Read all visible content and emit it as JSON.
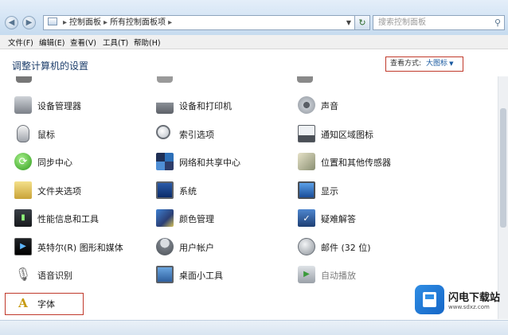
{
  "address": {
    "segments": [
      "控制面板",
      "所有控制面板项"
    ],
    "search_placeholder": "搜索控制面板"
  },
  "menu": [
    "文件(F)",
    "编辑(E)",
    "查看(V)",
    "工具(T)",
    "帮助(H)"
  ],
  "heading": "调整计算机的设置",
  "view_by": {
    "label": "查看方式:",
    "value": "大图标"
  },
  "items": [
    {
      "label": "设备管理器",
      "icon": "device-manager-icon"
    },
    {
      "label": "设备和打印机",
      "icon": "printer-icon"
    },
    {
      "label": "声音",
      "icon": "speaker-icon"
    },
    {
      "label": "鼠标",
      "icon": "mouse-icon"
    },
    {
      "label": "索引选项",
      "icon": "indexing-icon"
    },
    {
      "label": "通知区域图标",
      "icon": "notification-icon"
    },
    {
      "label": "同步中心",
      "icon": "sync-icon"
    },
    {
      "label": "网络和共享中心",
      "icon": "network-icon"
    },
    {
      "label": "位置和其他传感器",
      "icon": "sensor-icon"
    },
    {
      "label": "文件夹选项",
      "icon": "folder-icon"
    },
    {
      "label": "系统",
      "icon": "computer-icon"
    },
    {
      "label": "显示",
      "icon": "display-icon"
    },
    {
      "label": "性能信息和工具",
      "icon": "performance-icon"
    },
    {
      "label": "颜色管理",
      "icon": "color-icon"
    },
    {
      "label": "疑难解答",
      "icon": "troubleshoot-icon"
    },
    {
      "label": "英特尔(R) 图形和媒体",
      "icon": "intel-graphics-icon"
    },
    {
      "label": "用户帐户",
      "icon": "users-icon"
    },
    {
      "label": "邮件 (32 位)",
      "icon": "mail-icon"
    },
    {
      "label": "语音识别",
      "icon": "microphone-icon"
    },
    {
      "label": "桌面小工具",
      "icon": "gadgets-icon"
    },
    {
      "label": "自动播放",
      "icon": "autoplay-icon"
    },
    {
      "label": "字体",
      "icon": "fonts-icon"
    }
  ],
  "watermark": {
    "title": "闪电下载站",
    "url": "www.sdxz.com"
  },
  "colors": {
    "highlight": "#c0392b",
    "heading": "#1e3f6c",
    "link": "#1a5aa0"
  }
}
